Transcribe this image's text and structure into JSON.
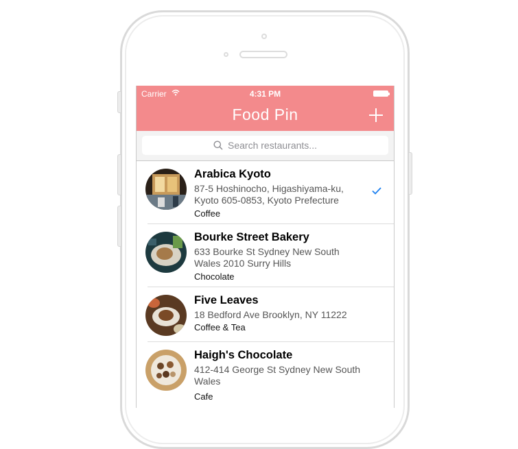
{
  "status_bar": {
    "carrier": "Carrier",
    "time": "4:31 PM"
  },
  "nav": {
    "title": "Food Pin",
    "add_icon": "plus-icon"
  },
  "search": {
    "placeholder": "Search restaurants..."
  },
  "colors": {
    "nav_background": "#f38a8c",
    "checkmark": "#1a7ff0"
  },
  "restaurants": [
    {
      "name": "Arabica Kyoto",
      "address": "87-5 Hoshinocho, Higashiyama-ku, Kyoto 605-0853, Kyoto Prefecture",
      "type": "Coffee",
      "checked": true
    },
    {
      "name": "Bourke Street Bakery",
      "address": "633 Bourke St Sydney New South Wales 2010 Surry Hills",
      "type": "Chocolate",
      "checked": false
    },
    {
      "name": "Five Leaves",
      "address": "18 Bedford Ave Brooklyn, NY 11222",
      "type": "Coffee & Tea",
      "checked": false
    },
    {
      "name": "Haigh's Chocolate",
      "address": "412-414 George St Sydney New South Wales",
      "type": "Cafe",
      "checked": false
    }
  ]
}
